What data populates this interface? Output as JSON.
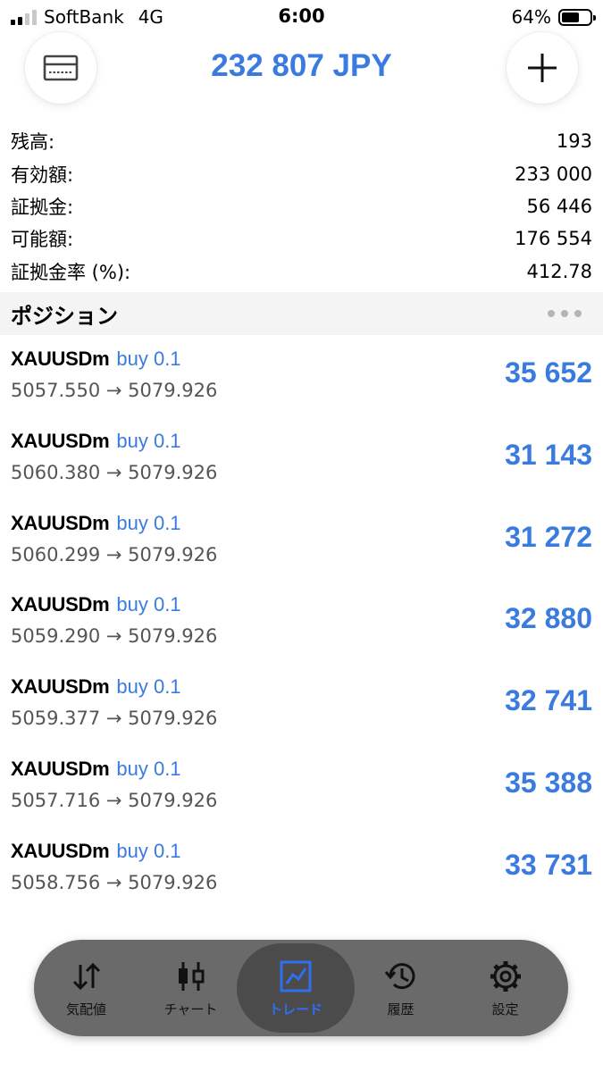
{
  "status_bar": {
    "carrier": "SoftBank",
    "network": "4G",
    "time": "6:00",
    "battery_percent": "64%",
    "battery_level": 0.64
  },
  "header": {
    "title": "232 807 JPY",
    "left_icon": "card-icon",
    "right_icon": "plus-icon"
  },
  "account": [
    {
      "label": "残高:",
      "value": "193"
    },
    {
      "label": "有効額:",
      "value": "233 000"
    },
    {
      "label": "証拠金:",
      "value": "56 446"
    },
    {
      "label": "可能額:",
      "value": "176 554"
    },
    {
      "label": "証拠金率 (%):",
      "value": "412.78"
    }
  ],
  "positions": {
    "title": "ポジション",
    "items": [
      {
        "symbol": "XAUUSDm",
        "side": "buy 0.1",
        "prices": "5057.550 → 5079.926",
        "profit": "35 652"
      },
      {
        "symbol": "XAUUSDm",
        "side": "buy 0.1",
        "prices": "5060.380 → 5079.926",
        "profit": "31 143"
      },
      {
        "symbol": "XAUUSDm",
        "side": "buy 0.1",
        "prices": "5060.299 → 5079.926",
        "profit": "31 272"
      },
      {
        "symbol": "XAUUSDm",
        "side": "buy 0.1",
        "prices": "5059.290 → 5079.926",
        "profit": "32 880"
      },
      {
        "symbol": "XAUUSDm",
        "side": "buy 0.1",
        "prices": "5059.377 → 5079.926",
        "profit": "32 741"
      },
      {
        "symbol": "XAUUSDm",
        "side": "buy 0.1",
        "prices": "5057.716 → 5079.926",
        "profit": "35 388"
      },
      {
        "symbol": "XAUUSDm",
        "side": "buy 0.1",
        "prices": "5058.756 → 5079.926",
        "profit": "33 731"
      }
    ]
  },
  "tabs": [
    {
      "label": "気配値",
      "icon": "quotes-icon"
    },
    {
      "label": "チャート",
      "icon": "chart-icon"
    },
    {
      "label": "トレード",
      "icon": "trade-icon",
      "active": true
    },
    {
      "label": "履歴",
      "icon": "history-icon"
    },
    {
      "label": "設定",
      "icon": "settings-icon"
    }
  ],
  "colors": {
    "accent": "#3a7be0",
    "tabbar_bg": "#6a6a6a",
    "active_tab_bg": "#4b4b4b",
    "section_bg": "#f4f4f4"
  }
}
